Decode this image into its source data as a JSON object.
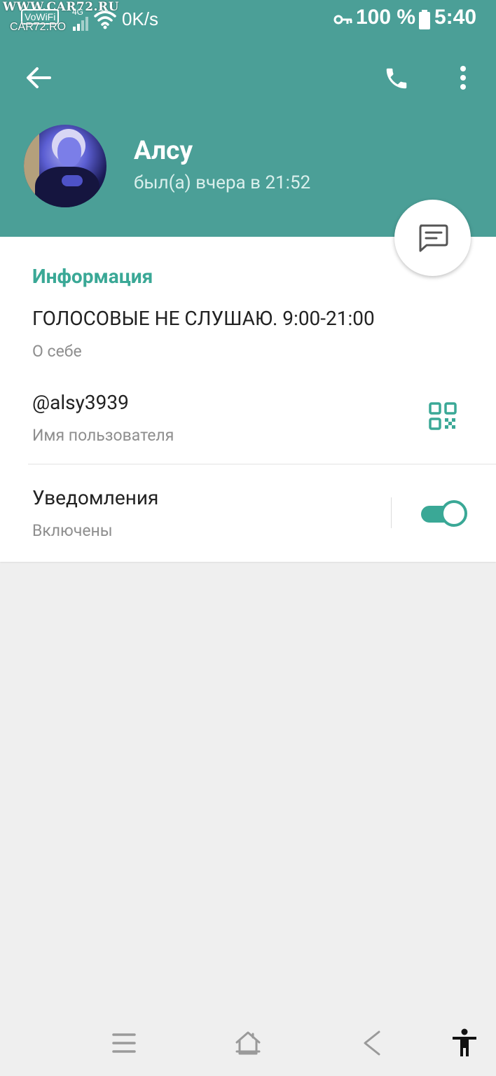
{
  "status_bar": {
    "watermark_top": "WWW.CAR72.RU",
    "watermark_bottom": "CAR72.RO",
    "vowifi": "VoWiFi",
    "network_type": "4G",
    "speed": "0K/s",
    "battery": "100 %",
    "time": "5:40"
  },
  "header": {
    "name": "Алсу",
    "last_seen": "был(а) вчера в 21:52",
    "icons": {
      "back": "arrow-left-icon",
      "call": "phone-icon",
      "more": "more-vert-icon",
      "message": "message-icon"
    }
  },
  "info": {
    "section_title": "Информация",
    "bio": {
      "value": "ГОЛОСОВЫЕ НЕ СЛУШАЮ. 9:00-21:00",
      "caption": "О себе"
    },
    "username": {
      "value": "@alsy3939",
      "caption": "Имя пользователя",
      "icon": "qr-code-icon"
    },
    "notifications": {
      "value": "Уведомления",
      "caption": "Включены",
      "enabled": true
    }
  },
  "nav_bar": {
    "icons": [
      "menu-icon",
      "home-icon",
      "back-icon",
      "accessibility-icon"
    ]
  },
  "colors": {
    "header_bg": "#4b9f97",
    "accent": "#3aa896",
    "page_bg": "#efefef"
  }
}
